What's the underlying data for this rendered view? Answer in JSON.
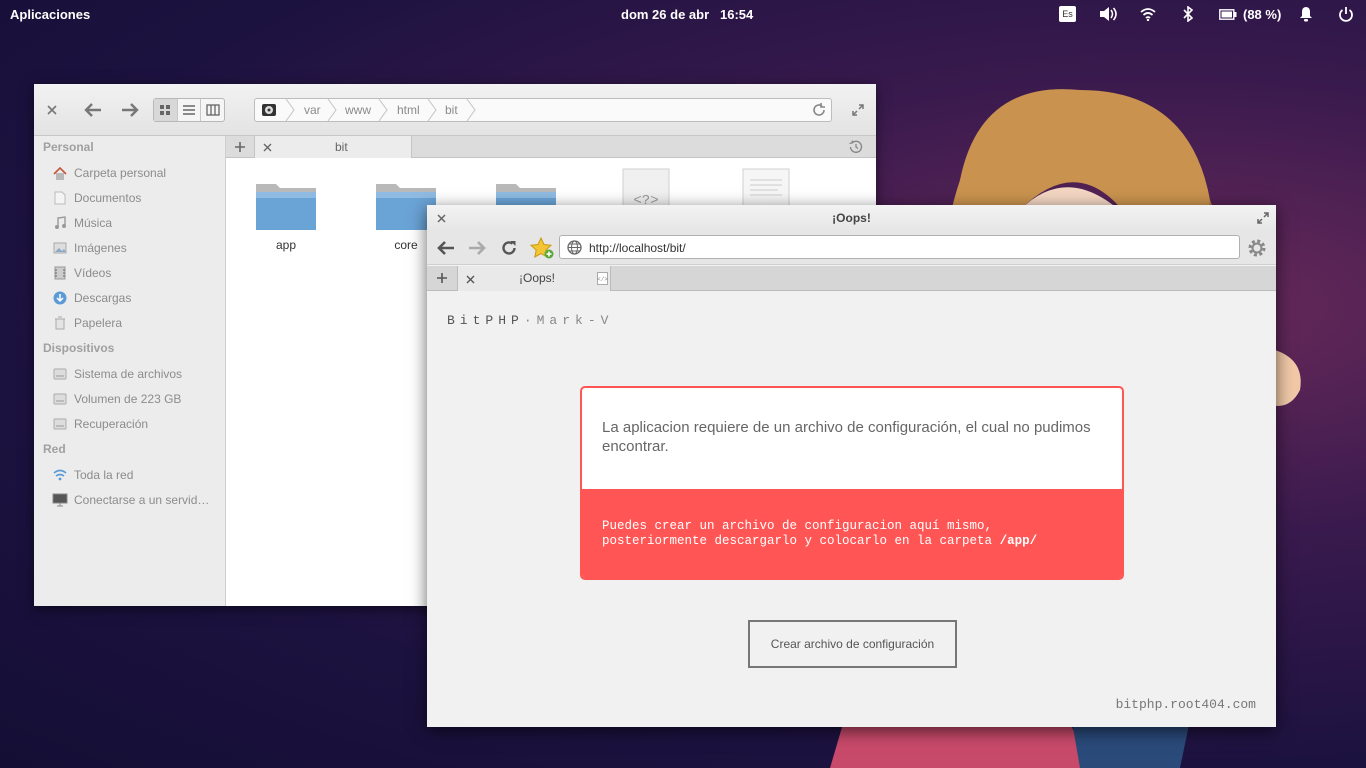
{
  "panel": {
    "apps_label": "Aplicaciones",
    "datetime": "dom 26 de abr",
    "time": "16:54",
    "keyboard_layout": "Es",
    "battery": "(88 %)"
  },
  "file_manager": {
    "path": [
      "var",
      "www",
      "html",
      "bit"
    ],
    "tab_label": "bit",
    "sidebar": {
      "sections": [
        {
          "title": "Personal",
          "items": [
            {
              "label": "Carpeta personal",
              "icon": "home-icon"
            },
            {
              "label": "Documentos",
              "icon": "document-icon"
            },
            {
              "label": "Música",
              "icon": "music-icon"
            },
            {
              "label": "Imágenes",
              "icon": "image-icon"
            },
            {
              "label": "Vídeos",
              "icon": "video-icon"
            },
            {
              "label": "Descargas",
              "icon": "download-icon"
            },
            {
              "label": "Papelera",
              "icon": "trash-icon"
            }
          ]
        },
        {
          "title": "Dispositivos",
          "items": [
            {
              "label": "Sistema de archivos",
              "icon": "drive-icon"
            },
            {
              "label": "Volumen de 223 GB",
              "icon": "drive-icon"
            },
            {
              "label": "Recuperación",
              "icon": "drive-icon"
            }
          ]
        },
        {
          "title": "Red",
          "items": [
            {
              "label": "Toda la red",
              "icon": "network-icon"
            },
            {
              "label": "Conectarse a un servid…",
              "icon": "monitor-icon"
            }
          ]
        }
      ]
    },
    "files": [
      {
        "name": "app",
        "type": "folder"
      },
      {
        "name": "core",
        "type": "folder"
      },
      {
        "name": "",
        "type": "folder"
      },
      {
        "name": "",
        "type": "php"
      },
      {
        "name": "",
        "type": "text"
      }
    ]
  },
  "browser": {
    "window_title": "¡Oops!",
    "url": "http://localhost/bit/",
    "tab_title": "¡Oops!",
    "brand_main": "BitPHP",
    "brand_sep": "·",
    "brand_sub": "Mark-V",
    "message": "La aplicacion requiere de un archivo de configuración, el cual no pudimos encontrar.",
    "hint_line1": "Puedes crear un archivo de configuracion aquí mismo,",
    "hint_line2": "posteriormente descargarlo y colocarlo en la carpeta",
    "hint_path": "/app/",
    "button_label": "Crear archivo de configuración",
    "footer": "bitphp.root404.com"
  },
  "colors": {
    "accent_red": "#ff5555",
    "folder_blue": "#6aa3d6"
  }
}
